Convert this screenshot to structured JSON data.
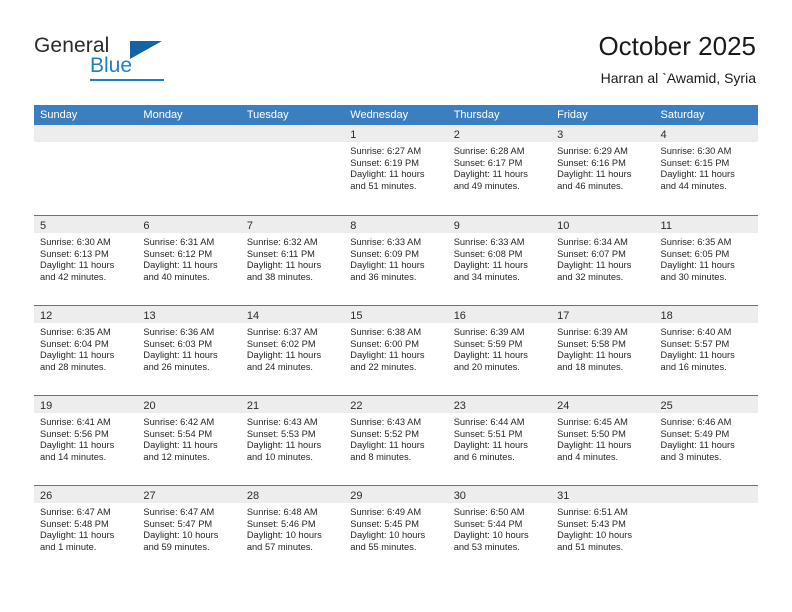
{
  "brand": {
    "name_part1": "General",
    "name_part2": "Blue",
    "flag_icon": "brand-flag-icon"
  },
  "header": {
    "title": "October 2025",
    "subtitle": "Harran al `Awamid, Syria"
  },
  "calendar": {
    "weekday_headers": [
      "Sunday",
      "Monday",
      "Tuesday",
      "Wednesday",
      "Thursday",
      "Friday",
      "Saturday"
    ],
    "colors": {
      "header_blue": "#3c7fc1",
      "day_band_gray": "#ededed",
      "text": "#262626",
      "brand_blue": "#1f7fc4"
    },
    "weeks": [
      [
        {
          "day": "",
          "lines": []
        },
        {
          "day": "",
          "lines": []
        },
        {
          "day": "",
          "lines": []
        },
        {
          "day": "1",
          "lines": [
            "Sunrise: 6:27 AM",
            "Sunset: 6:19 PM",
            "Daylight: 11 hours",
            "and 51 minutes."
          ]
        },
        {
          "day": "2",
          "lines": [
            "Sunrise: 6:28 AM",
            "Sunset: 6:17 PM",
            "Daylight: 11 hours",
            "and 49 minutes."
          ]
        },
        {
          "day": "3",
          "lines": [
            "Sunrise: 6:29 AM",
            "Sunset: 6:16 PM",
            "Daylight: 11 hours",
            "and 46 minutes."
          ]
        },
        {
          "day": "4",
          "lines": [
            "Sunrise: 6:30 AM",
            "Sunset: 6:15 PM",
            "Daylight: 11 hours",
            "and 44 minutes."
          ]
        }
      ],
      [
        {
          "day": "5",
          "lines": [
            "Sunrise: 6:30 AM",
            "Sunset: 6:13 PM",
            "Daylight: 11 hours",
            "and 42 minutes."
          ]
        },
        {
          "day": "6",
          "lines": [
            "Sunrise: 6:31 AM",
            "Sunset: 6:12 PM",
            "Daylight: 11 hours",
            "and 40 minutes."
          ]
        },
        {
          "day": "7",
          "lines": [
            "Sunrise: 6:32 AM",
            "Sunset: 6:11 PM",
            "Daylight: 11 hours",
            "and 38 minutes."
          ]
        },
        {
          "day": "8",
          "lines": [
            "Sunrise: 6:33 AM",
            "Sunset: 6:09 PM",
            "Daylight: 11 hours",
            "and 36 minutes."
          ]
        },
        {
          "day": "9",
          "lines": [
            "Sunrise: 6:33 AM",
            "Sunset: 6:08 PM",
            "Daylight: 11 hours",
            "and 34 minutes."
          ]
        },
        {
          "day": "10",
          "lines": [
            "Sunrise: 6:34 AM",
            "Sunset: 6:07 PM",
            "Daylight: 11 hours",
            "and 32 minutes."
          ]
        },
        {
          "day": "11",
          "lines": [
            "Sunrise: 6:35 AM",
            "Sunset: 6:05 PM",
            "Daylight: 11 hours",
            "and 30 minutes."
          ]
        }
      ],
      [
        {
          "day": "12",
          "lines": [
            "Sunrise: 6:35 AM",
            "Sunset: 6:04 PM",
            "Daylight: 11 hours",
            "and 28 minutes."
          ]
        },
        {
          "day": "13",
          "lines": [
            "Sunrise: 6:36 AM",
            "Sunset: 6:03 PM",
            "Daylight: 11 hours",
            "and 26 minutes."
          ]
        },
        {
          "day": "14",
          "lines": [
            "Sunrise: 6:37 AM",
            "Sunset: 6:02 PM",
            "Daylight: 11 hours",
            "and 24 minutes."
          ]
        },
        {
          "day": "15",
          "lines": [
            "Sunrise: 6:38 AM",
            "Sunset: 6:00 PM",
            "Daylight: 11 hours",
            "and 22 minutes."
          ]
        },
        {
          "day": "16",
          "lines": [
            "Sunrise: 6:39 AM",
            "Sunset: 5:59 PM",
            "Daylight: 11 hours",
            "and 20 minutes."
          ]
        },
        {
          "day": "17",
          "lines": [
            "Sunrise: 6:39 AM",
            "Sunset: 5:58 PM",
            "Daylight: 11 hours",
            "and 18 minutes."
          ]
        },
        {
          "day": "18",
          "lines": [
            "Sunrise: 6:40 AM",
            "Sunset: 5:57 PM",
            "Daylight: 11 hours",
            "and 16 minutes."
          ]
        }
      ],
      [
        {
          "day": "19",
          "lines": [
            "Sunrise: 6:41 AM",
            "Sunset: 5:56 PM",
            "Daylight: 11 hours",
            "and 14 minutes."
          ]
        },
        {
          "day": "20",
          "lines": [
            "Sunrise: 6:42 AM",
            "Sunset: 5:54 PM",
            "Daylight: 11 hours",
            "and 12 minutes."
          ]
        },
        {
          "day": "21",
          "lines": [
            "Sunrise: 6:43 AM",
            "Sunset: 5:53 PM",
            "Daylight: 11 hours",
            "and 10 minutes."
          ]
        },
        {
          "day": "22",
          "lines": [
            "Sunrise: 6:43 AM",
            "Sunset: 5:52 PM",
            "Daylight: 11 hours",
            "and 8 minutes."
          ]
        },
        {
          "day": "23",
          "lines": [
            "Sunrise: 6:44 AM",
            "Sunset: 5:51 PM",
            "Daylight: 11 hours",
            "and 6 minutes."
          ]
        },
        {
          "day": "24",
          "lines": [
            "Sunrise: 6:45 AM",
            "Sunset: 5:50 PM",
            "Daylight: 11 hours",
            "and 4 minutes."
          ]
        },
        {
          "day": "25",
          "lines": [
            "Sunrise: 6:46 AM",
            "Sunset: 5:49 PM",
            "Daylight: 11 hours",
            "and 3 minutes."
          ]
        }
      ],
      [
        {
          "day": "26",
          "lines": [
            "Sunrise: 6:47 AM",
            "Sunset: 5:48 PM",
            "Daylight: 11 hours",
            "and 1 minute."
          ]
        },
        {
          "day": "27",
          "lines": [
            "Sunrise: 6:47 AM",
            "Sunset: 5:47 PM",
            "Daylight: 10 hours",
            "and 59 minutes."
          ]
        },
        {
          "day": "28",
          "lines": [
            "Sunrise: 6:48 AM",
            "Sunset: 5:46 PM",
            "Daylight: 10 hours",
            "and 57 minutes."
          ]
        },
        {
          "day": "29",
          "lines": [
            "Sunrise: 6:49 AM",
            "Sunset: 5:45 PM",
            "Daylight: 10 hours",
            "and 55 minutes."
          ]
        },
        {
          "day": "30",
          "lines": [
            "Sunrise: 6:50 AM",
            "Sunset: 5:44 PM",
            "Daylight: 10 hours",
            "and 53 minutes."
          ]
        },
        {
          "day": "31",
          "lines": [
            "Sunrise: 6:51 AM",
            "Sunset: 5:43 PM",
            "Daylight: 10 hours",
            "and 51 minutes."
          ]
        },
        {
          "day": "",
          "lines": []
        }
      ]
    ]
  }
}
